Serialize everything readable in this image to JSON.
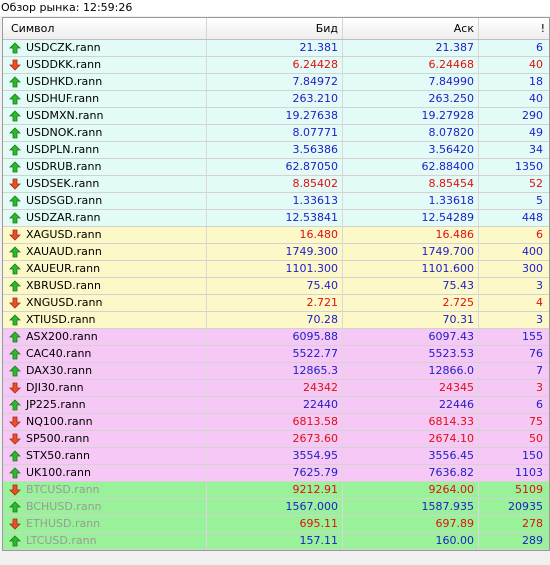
{
  "window": {
    "title": "Обзор рынка: 12:59:26"
  },
  "colors": {
    "fx": "#e3fbf6",
    "commodities": "#fdf8c8",
    "indices": "#f6c8f6",
    "crypto": "#99f199",
    "up": "#1d1dc8",
    "down": "#e01010"
  },
  "columns": {
    "symbol": "Символ",
    "bid": "Бид",
    "ask": "Аск",
    "spread": "!"
  },
  "rows": [
    {
      "symbol": "USDCZK.rann",
      "bid": "21.381",
      "ask": "21.387",
      "spread": "6",
      "dir": "up",
      "group": "fx"
    },
    {
      "symbol": "USDDKK.rann",
      "bid": "6.24428",
      "ask": "6.24468",
      "spread": "40",
      "dir": "down",
      "group": "fx"
    },
    {
      "symbol": "USDHKD.rann",
      "bid": "7.84972",
      "ask": "7.84990",
      "spread": "18",
      "dir": "up",
      "group": "fx"
    },
    {
      "symbol": "USDHUF.rann",
      "bid": "263.210",
      "ask": "263.250",
      "spread": "40",
      "dir": "up",
      "group": "fx"
    },
    {
      "symbol": "USDMXN.rann",
      "bid": "19.27638",
      "ask": "19.27928",
      "spread": "290",
      "dir": "up",
      "group": "fx"
    },
    {
      "symbol": "USDNOK.rann",
      "bid": "8.07771",
      "ask": "8.07820",
      "spread": "49",
      "dir": "up",
      "group": "fx"
    },
    {
      "symbol": "USDPLN.rann",
      "bid": "3.56386",
      "ask": "3.56420",
      "spread": "34",
      "dir": "up",
      "group": "fx"
    },
    {
      "symbol": "USDRUB.rann",
      "bid": "62.87050",
      "ask": "62.88400",
      "spread": "1350",
      "dir": "up",
      "group": "fx"
    },
    {
      "symbol": "USDSEK.rann",
      "bid": "8.85402",
      "ask": "8.85454",
      "spread": "52",
      "dir": "down",
      "group": "fx"
    },
    {
      "symbol": "USDSGD.rann",
      "bid": "1.33613",
      "ask": "1.33618",
      "spread": "5",
      "dir": "up",
      "group": "fx"
    },
    {
      "symbol": "USDZAR.rann",
      "bid": "12.53841",
      "ask": "12.54289",
      "spread": "448",
      "dir": "up",
      "group": "fx"
    },
    {
      "symbol": "XAGUSD.rann",
      "bid": "16.480",
      "ask": "16.486",
      "spread": "6",
      "dir": "down",
      "group": "commodities"
    },
    {
      "symbol": "XAUAUD.rann",
      "bid": "1749.300",
      "ask": "1749.700",
      "spread": "400",
      "dir": "up",
      "group": "commodities"
    },
    {
      "symbol": "XAUEUR.rann",
      "bid": "1101.300",
      "ask": "1101.600",
      "spread": "300",
      "dir": "up",
      "group": "commodities"
    },
    {
      "symbol": "XBRUSD.rann",
      "bid": "75.40",
      "ask": "75.43",
      "spread": "3",
      "dir": "up",
      "group": "commodities"
    },
    {
      "symbol": "XNGUSD.rann",
      "bid": "2.721",
      "ask": "2.725",
      "spread": "4",
      "dir": "down",
      "group": "commodities"
    },
    {
      "symbol": "XTIUSD.rann",
      "bid": "70.28",
      "ask": "70.31",
      "spread": "3",
      "dir": "up",
      "group": "commodities"
    },
    {
      "symbol": "ASX200.rann",
      "bid": "6095.88",
      "ask": "6097.43",
      "spread": "155",
      "dir": "up",
      "group": "indices"
    },
    {
      "symbol": "CAC40.rann",
      "bid": "5522.77",
      "ask": "5523.53",
      "spread": "76",
      "dir": "up",
      "group": "indices"
    },
    {
      "symbol": "DAX30.rann",
      "bid": "12865.3",
      "ask": "12866.0",
      "spread": "7",
      "dir": "up",
      "group": "indices"
    },
    {
      "symbol": "DJI30.rann",
      "bid": "24342",
      "ask": "24345",
      "spread": "3",
      "dir": "down",
      "group": "indices"
    },
    {
      "symbol": "JP225.rann",
      "bid": "22440",
      "ask": "22446",
      "spread": "6",
      "dir": "up",
      "group": "indices"
    },
    {
      "symbol": "NQ100.rann",
      "bid": "6813.58",
      "ask": "6814.33",
      "spread": "75",
      "dir": "down",
      "group": "indices"
    },
    {
      "symbol": "SP500.rann",
      "bid": "2673.60",
      "ask": "2674.10",
      "spread": "50",
      "dir": "down",
      "group": "indices"
    },
    {
      "symbol": "STX50.rann",
      "bid": "3554.95",
      "ask": "3556.45",
      "spread": "150",
      "dir": "up",
      "group": "indices"
    },
    {
      "symbol": "UK100.rann",
      "bid": "7625.79",
      "ask": "7636.82",
      "spread": "1103",
      "dir": "up",
      "group": "indices"
    },
    {
      "symbol": "BTCUSD.rann",
      "bid": "9212.91",
      "ask": "9264.00",
      "spread": "5109",
      "dir": "down",
      "group": "crypto",
      "dim": true
    },
    {
      "symbol": "BCHUSD.rann",
      "bid": "1567.000",
      "ask": "1587.935",
      "spread": "20935",
      "dir": "up",
      "group": "crypto",
      "dim": true
    },
    {
      "symbol": "ETHUSD.rann",
      "bid": "695.11",
      "ask": "697.89",
      "spread": "278",
      "dir": "down",
      "group": "crypto",
      "dim": true
    },
    {
      "symbol": "LTCUSD.rann",
      "bid": "157.11",
      "ask": "160.00",
      "spread": "289",
      "dir": "up",
      "group": "crypto",
      "dim": true
    }
  ]
}
